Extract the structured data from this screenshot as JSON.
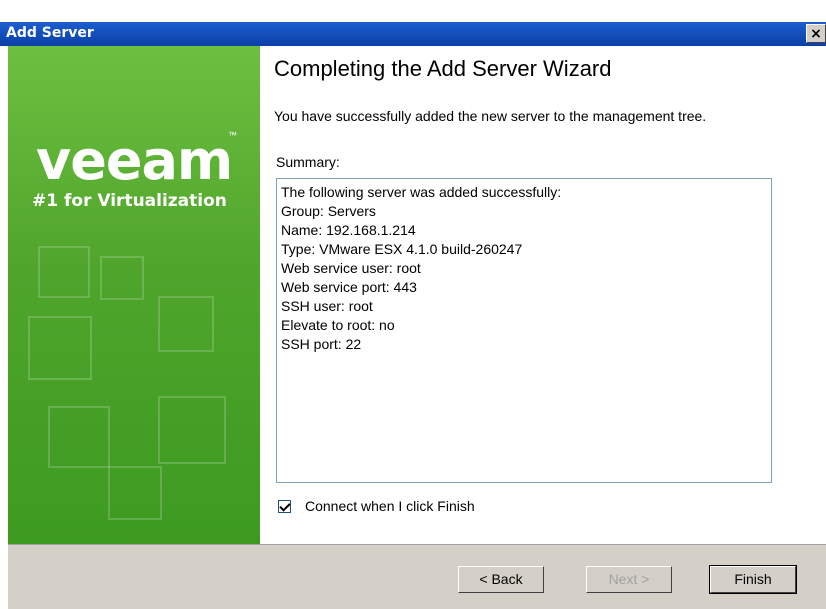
{
  "window": {
    "title": "Add Server",
    "close_glyph": "×"
  },
  "sidebar": {
    "logo_text": "veeam",
    "trademark": "™",
    "tagline": "#1 for Virtualization"
  },
  "content": {
    "heading": "Completing the Add Server Wizard",
    "description": "You have successfully added the new server to the management tree.",
    "summary_label": "Summary:",
    "summary_lines": [
      "The following server was added successfully:",
      "Group: Servers",
      "Name: 192.168.1.214",
      "Type: VMware ESX 4.1.0 build-260247",
      "Web service user: root",
      "Web service port: 443",
      "SSH user: root",
      "Elevate to root: no",
      "SSH port: 22"
    ],
    "connect_checkbox": {
      "label": "Connect when I click Finish",
      "checked": true
    }
  },
  "buttons": {
    "back": "< Back",
    "next": "Next >",
    "finish": "Finish"
  }
}
